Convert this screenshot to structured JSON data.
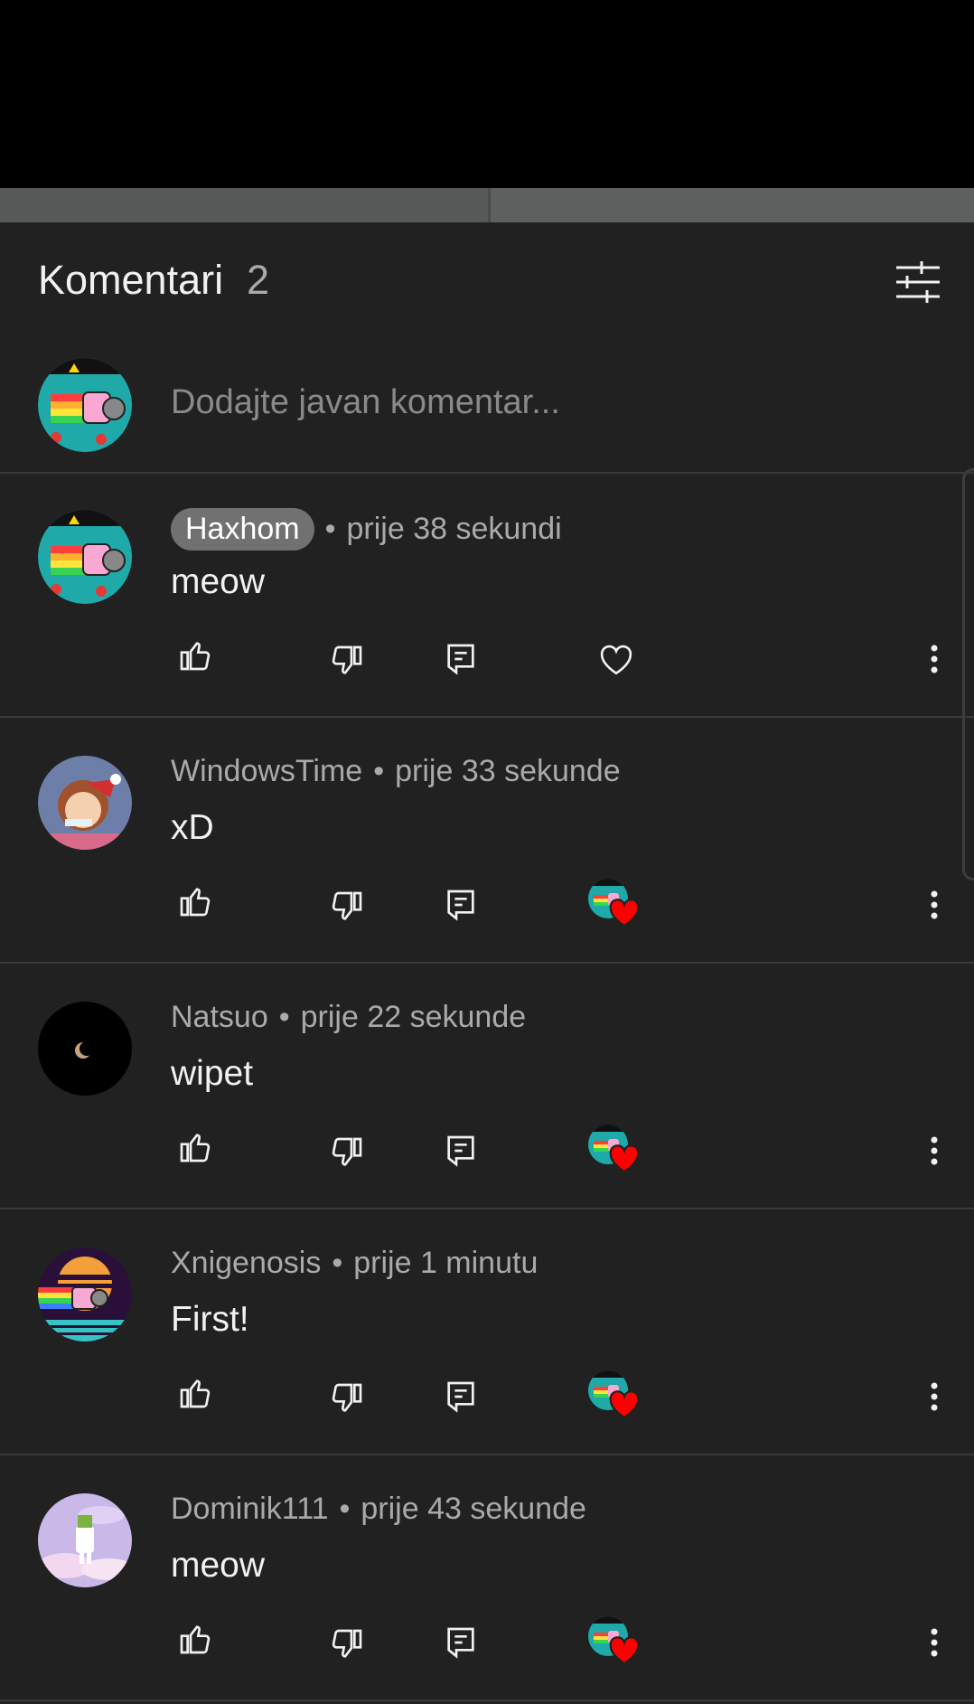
{
  "header": {
    "title": "Komentari",
    "count": "2"
  },
  "add_comment": {
    "placeholder": "Dodajte javan komentar..."
  },
  "comments": [
    {
      "author": "Haxhom",
      "time": "prije 38 sekundi",
      "text": "meow",
      "is_owner": true,
      "hearted": false
    },
    {
      "author": "WindowsTime",
      "time": "prije 33 sekunde",
      "text": "xD",
      "is_owner": false,
      "hearted": true
    },
    {
      "author": "Natsuo",
      "time": "prije 22 sekunde",
      "text": "wipet",
      "is_owner": false,
      "hearted": true
    },
    {
      "author": "Xnigenosis",
      "time": "prije 1 minutu",
      "text": "First!",
      "is_owner": false,
      "hearted": true
    },
    {
      "author": "Dominik111",
      "time": "prije 43 sekunde",
      "text": "meow",
      "is_owner": false,
      "hearted": true
    }
  ],
  "separator": "•",
  "icons": [
    "filter-icon",
    "like-icon",
    "dislike-icon",
    "reply-icon",
    "heart-icon",
    "more-icon"
  ],
  "colors": {
    "background": "#212121",
    "text": "#f1f1f1",
    "secondary_text": "#aaaaaa",
    "heart": "#ff0000"
  }
}
